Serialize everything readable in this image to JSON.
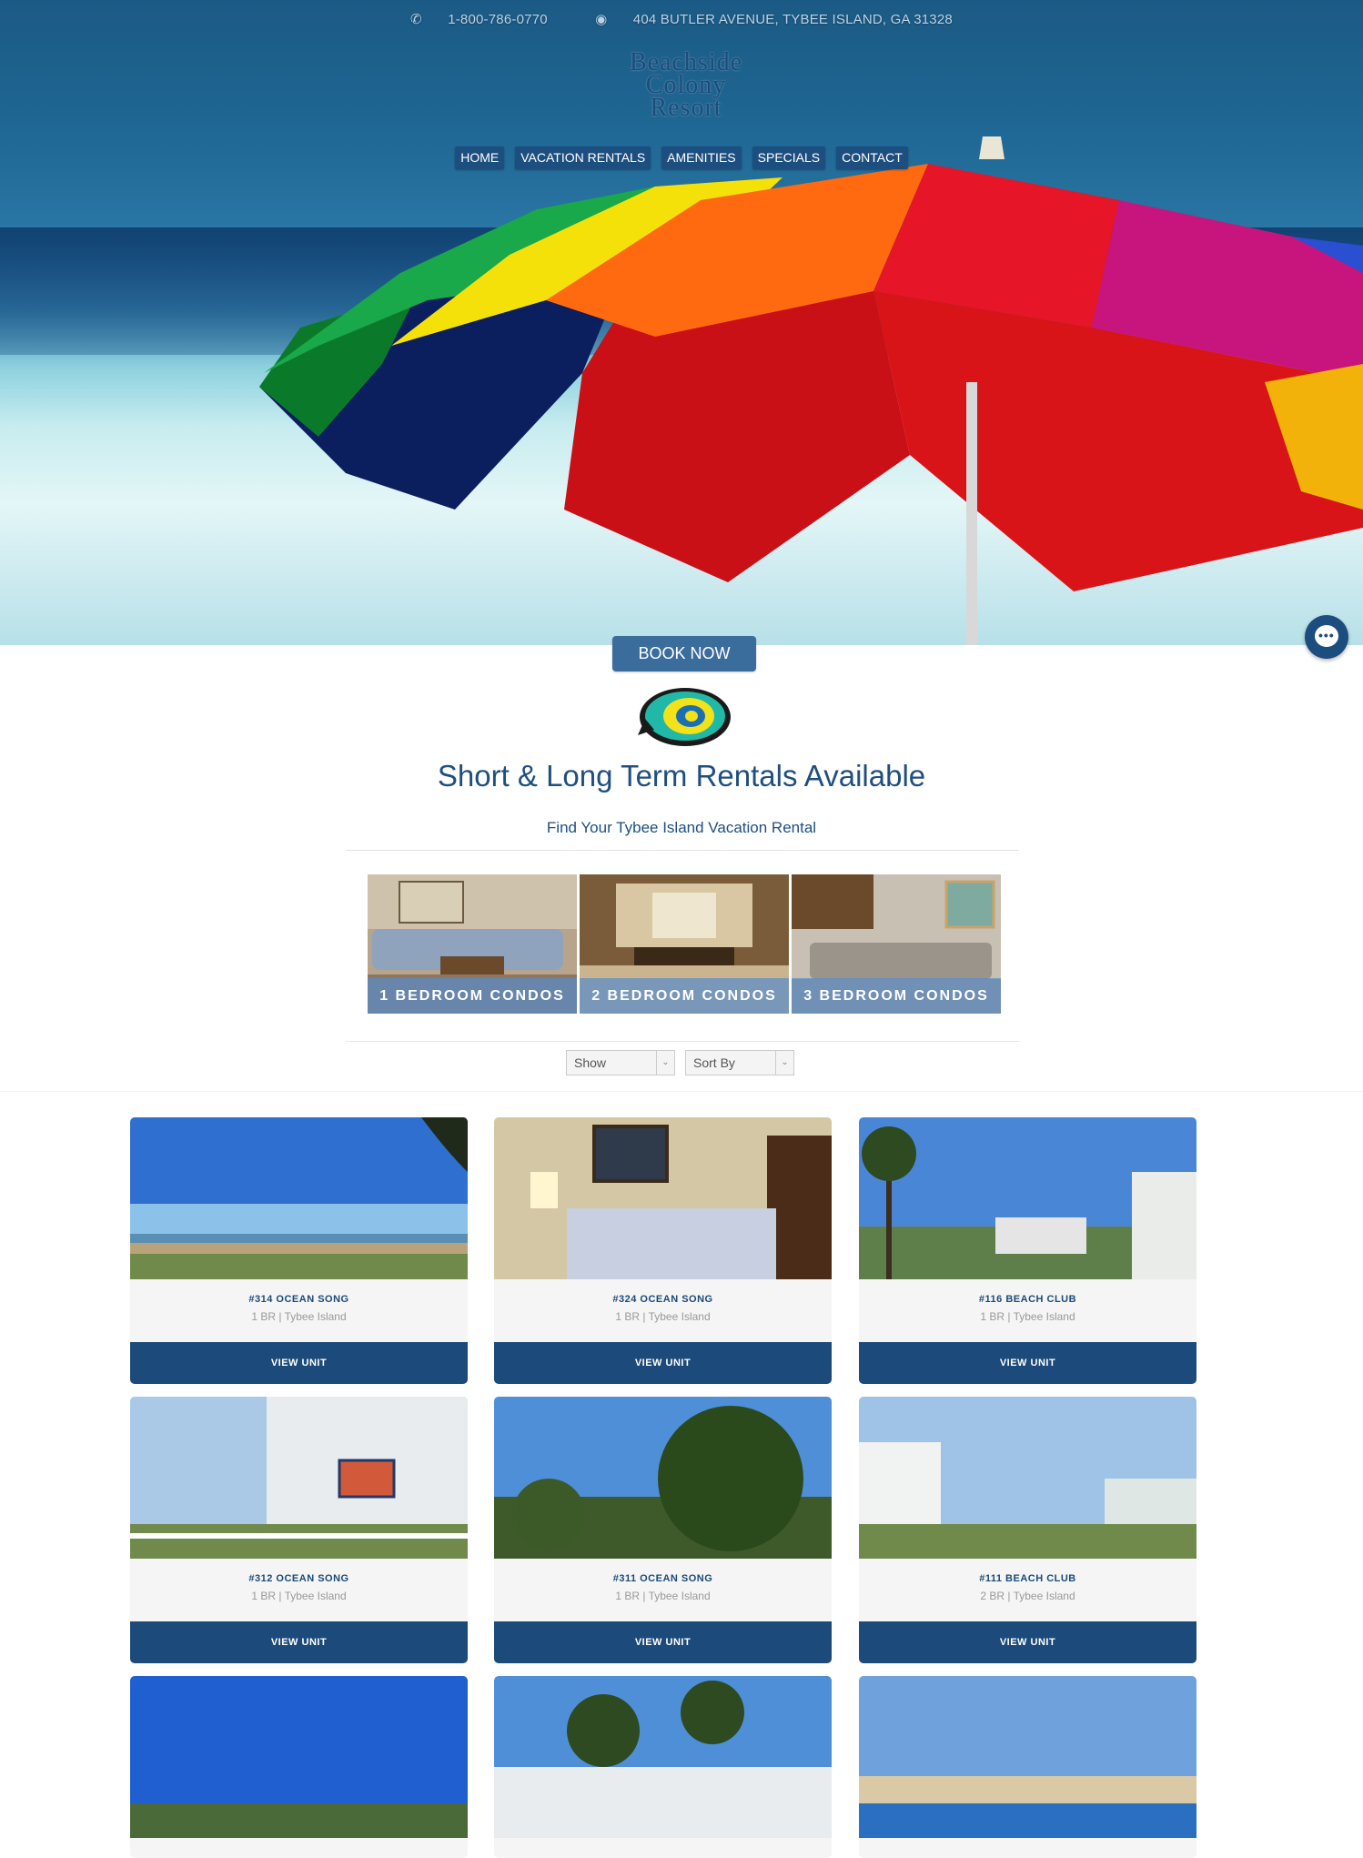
{
  "topbar": {
    "phone": "1-800-786-0770",
    "address": "404 BUTLER AVENUE, TYBEE ISLAND, GA 31328",
    "phone_icon": "phone-icon",
    "address_icon": "map-pin-icon"
  },
  "logo": {
    "line1": "Beachside",
    "line2": "Colony",
    "line3": "Resort"
  },
  "nav": [
    "HOME",
    "VACATION RENTALS",
    "AMENITIES",
    "SPECIALS",
    "CONTACT"
  ],
  "book_now": "BOOK NOW",
  "tagline": "Short & Long Term Rentals Available",
  "subtagline": "Find Your Tybee Island Vacation Rental",
  "categories": [
    "1 BEDROOM CONDOS",
    "2 BEDROOM CONDOS",
    "3 BEDROOM CONDOS"
  ],
  "filters": {
    "show": "Show",
    "sort": "Sort By"
  },
  "units": [
    {
      "name": "#314 OCEAN SONG",
      "meta": "1 BR | Tybee Island",
      "button": "VIEW UNIT"
    },
    {
      "name": "#324 OCEAN SONG",
      "meta": "1 BR | Tybee Island",
      "button": "VIEW UNIT"
    },
    {
      "name": "#116 BEACH CLUB",
      "meta": "1 BR | Tybee Island",
      "button": "VIEW UNIT"
    },
    {
      "name": "#312 OCEAN SONG",
      "meta": "1 BR | Tybee Island",
      "button": "VIEW UNIT"
    },
    {
      "name": "#311 OCEAN SONG",
      "meta": "1 BR | Tybee Island",
      "button": "VIEW UNIT"
    },
    {
      "name": "#111 BEACH CLUB",
      "meta": "2 BR | Tybee Island",
      "button": "VIEW UNIT"
    }
  ],
  "colors": {
    "brand": "#1c4a7a",
    "accent": "#3b6d9c"
  }
}
